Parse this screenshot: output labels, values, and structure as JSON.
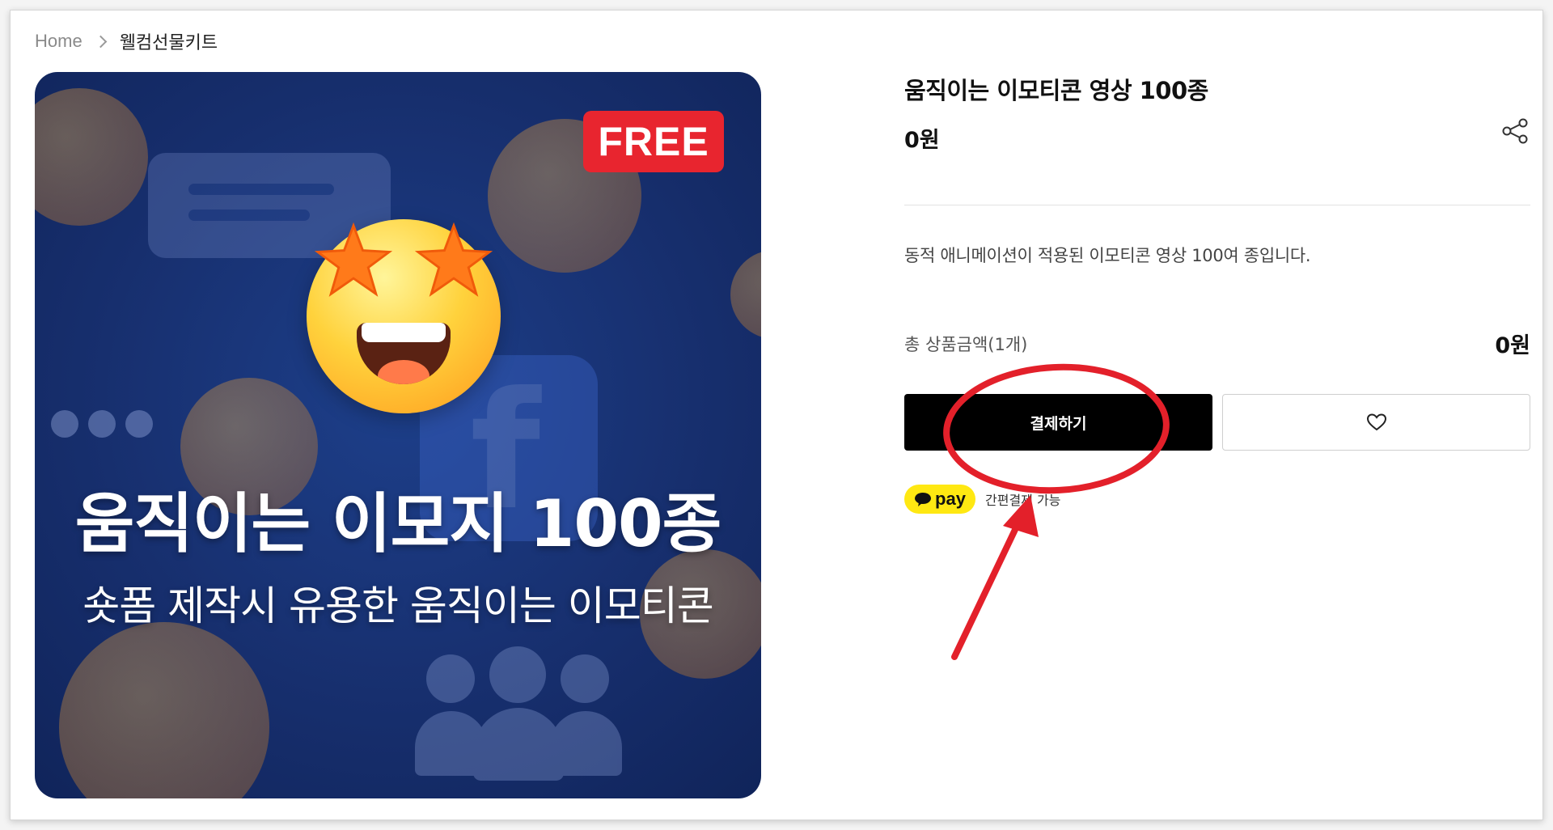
{
  "breadcrumb": {
    "home": "Home",
    "current": "웰컴선물키트"
  },
  "product_image": {
    "badge": "FREE",
    "headline": "움직이는 이모지 100종",
    "subline": "숏폼 제작시 유용한 움직이는 이모티콘",
    "facebook_letter": "f"
  },
  "product": {
    "title": "움직이는 이모티콘 영상 100종",
    "price": "0원",
    "description": "동적 애니메이션이 적용된 이모티콘 영상 100여 종입니다."
  },
  "order": {
    "total_label": "총 상품금액(1개)",
    "total_value": "0원",
    "pay_button_label": "결제하기"
  },
  "kakaopay": {
    "badge_label": "pay",
    "note": "간편결제 가능"
  },
  "colors": {
    "accent_red": "#e8252f",
    "annotation_red": "#e3202a",
    "kakao_yellow": "#ffe812",
    "button_black": "#000000"
  },
  "icons": {
    "breadcrumb_separator": "chevron-right-icon",
    "share": "share-icon",
    "wishlist": "heart-icon",
    "kakaopay": "speech-bubble-icon"
  }
}
